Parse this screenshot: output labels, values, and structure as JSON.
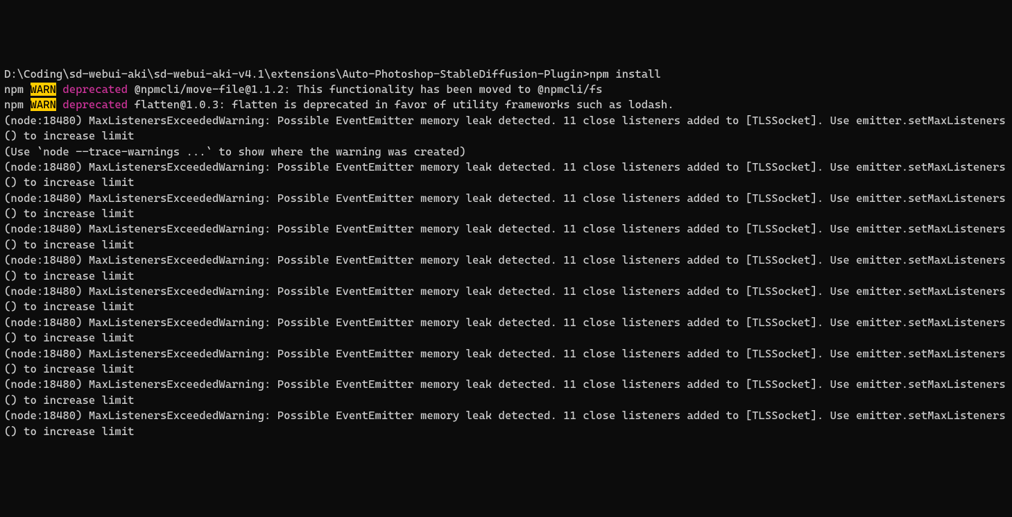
{
  "prompt": {
    "path": "D:\\Coding\\sd-webui-aki\\sd-webui-aki-v4.1\\extensions\\Auto-Photoshop-StableDiffusion-Plugin>",
    "command": "npm install"
  },
  "warnings": [
    {
      "prefix": "npm ",
      "badge": "WARN",
      "type": " deprecated ",
      "message": "@npmcli/move-file@1.1.2: This functionality has been moved to @npmcli/fs"
    },
    {
      "prefix": "npm ",
      "badge": "WARN",
      "type": " deprecated ",
      "message": "flatten@1.0.3: flatten is deprecated in favor of utility frameworks such as lodash."
    }
  ],
  "nodeWarnings": {
    "firstWarning": "(node:18480) MaxListenersExceededWarning: Possible EventEmitter memory leak detected. 11 close listeners added to [TLSSocket]. Use emitter.setMaxListeners() to increase limit",
    "traceHint": "(Use `node --trace-warnings ...` to show where the warning was created)",
    "repeatedWarning": "(node:18480) MaxListenersExceededWarning: Possible EventEmitter memory leak detected. 11 close listeners added to [TLSSocket]. Use emitter.setMaxListeners() to increase limit",
    "repeatCount": 9
  }
}
